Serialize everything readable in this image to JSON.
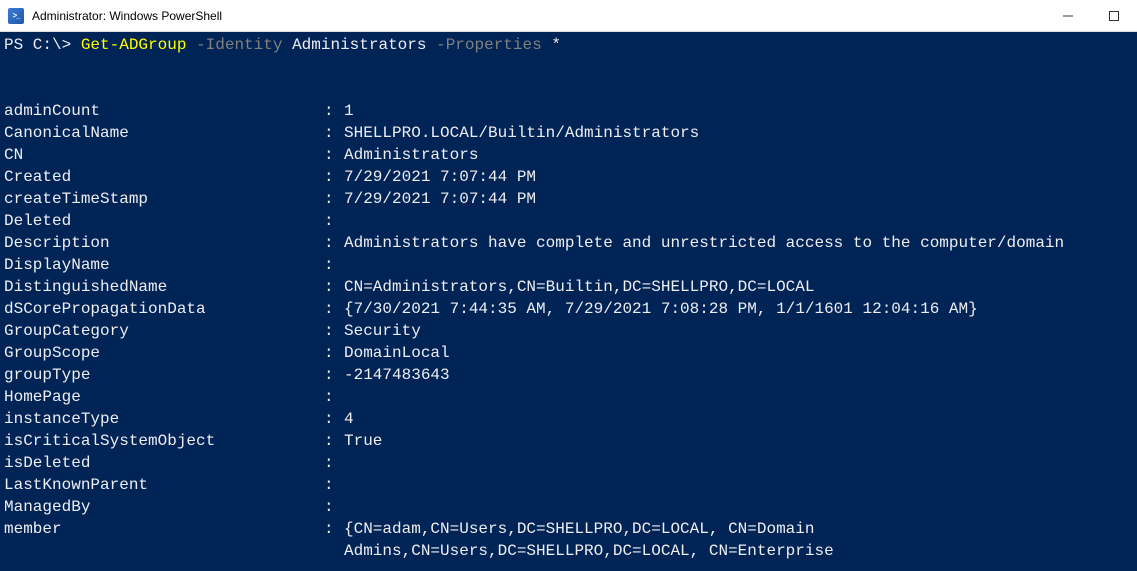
{
  "window": {
    "title": "Administrator: Windows PowerShell"
  },
  "prompt": {
    "ps": "PS C:\\> ",
    "cmdlet": "Get-ADGroup",
    "param1": " -Identity ",
    "arg1": "Administrators",
    "param2": " -Properties ",
    "arg2": "*"
  },
  "output": [
    {
      "key": "adminCount",
      "val": "1"
    },
    {
      "key": "CanonicalName",
      "val": "SHELLPRO.LOCAL/Builtin/Administrators"
    },
    {
      "key": "CN",
      "val": "Administrators"
    },
    {
      "key": "Created",
      "val": "7/29/2021 7:07:44 PM"
    },
    {
      "key": "createTimeStamp",
      "val": "7/29/2021 7:07:44 PM"
    },
    {
      "key": "Deleted",
      "val": ""
    },
    {
      "key": "Description",
      "val": "Administrators have complete and unrestricted access to the computer/domain"
    },
    {
      "key": "DisplayName",
      "val": ""
    },
    {
      "key": "DistinguishedName",
      "val": "CN=Administrators,CN=Builtin,DC=SHELLPRO,DC=LOCAL"
    },
    {
      "key": "dSCorePropagationData",
      "val": "{7/30/2021 7:44:35 AM, 7/29/2021 7:08:28 PM, 1/1/1601 12:04:16 AM}"
    },
    {
      "key": "GroupCategory",
      "val": "Security"
    },
    {
      "key": "GroupScope",
      "val": "DomainLocal"
    },
    {
      "key": "groupType",
      "val": "-2147483643"
    },
    {
      "key": "HomePage",
      "val": ""
    },
    {
      "key": "instanceType",
      "val": "4"
    },
    {
      "key": "isCriticalSystemObject",
      "val": "True"
    },
    {
      "key": "isDeleted",
      "val": ""
    },
    {
      "key": "LastKnownParent",
      "val": ""
    },
    {
      "key": "ManagedBy",
      "val": ""
    },
    {
      "key": "member",
      "val": "{CN=adam,CN=Users,DC=SHELLPRO,DC=LOCAL, CN=Domain"
    },
    {
      "key": "",
      "val": "Admins,CN=Users,DC=SHELLPRO,DC=LOCAL, CN=Enterprise"
    }
  ]
}
